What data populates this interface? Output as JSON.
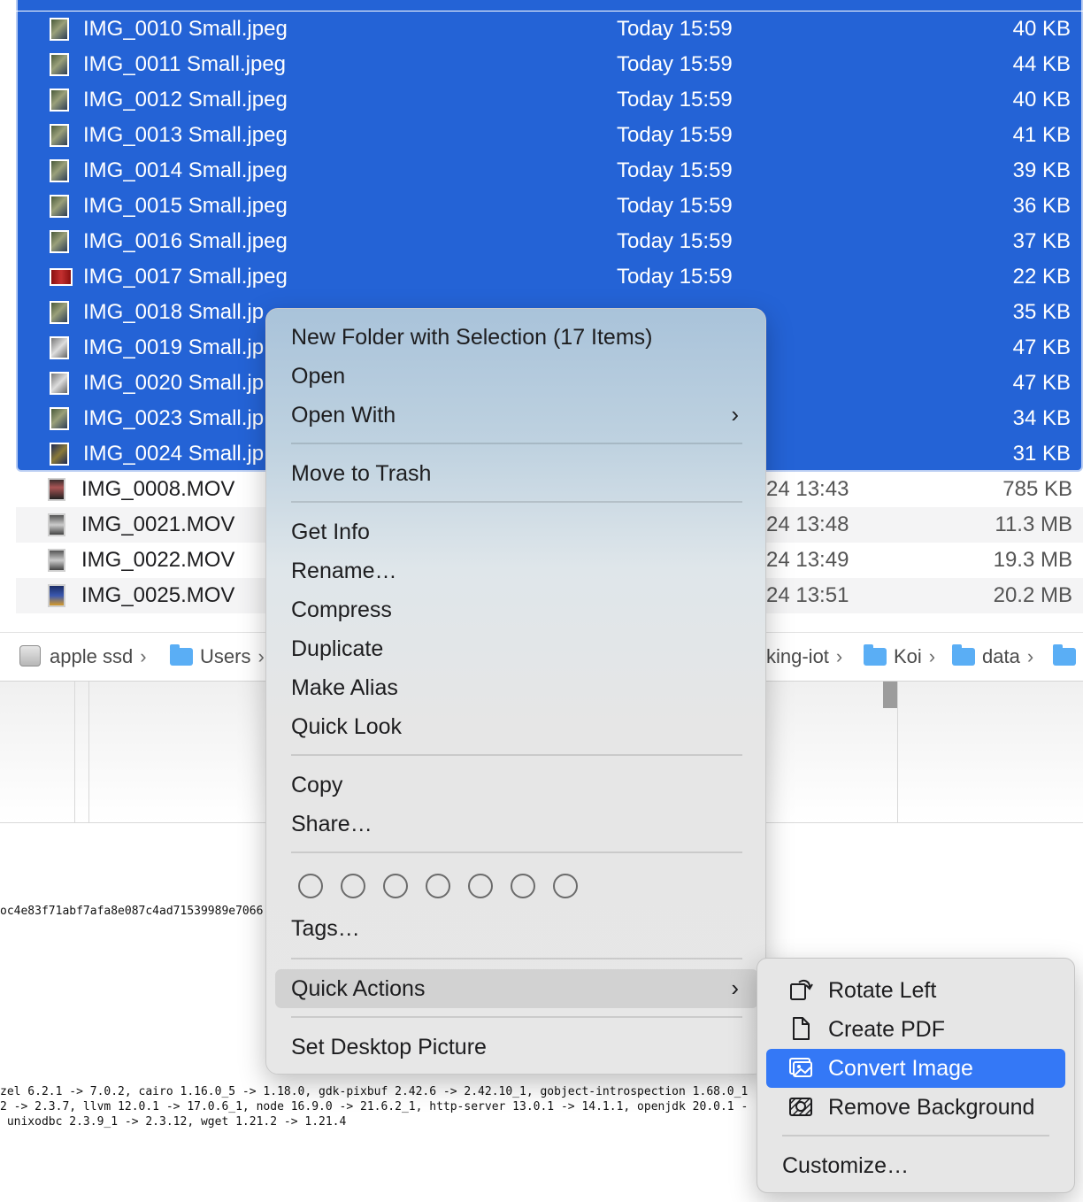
{
  "finder": {
    "selected_files": [
      {
        "name": "IMG_0010 Small.jpeg",
        "date": "Today 15:59",
        "size": "40 KB"
      },
      {
        "name": "IMG_0011 Small.jpeg",
        "date": "Today 15:59",
        "size": "44 KB"
      },
      {
        "name": "IMG_0012 Small.jpeg",
        "date": "Today 15:59",
        "size": "40 KB"
      },
      {
        "name": "IMG_0013 Small.jpeg",
        "date": "Today 15:59",
        "size": "41 KB"
      },
      {
        "name": "IMG_0014 Small.jpeg",
        "date": "Today 15:59",
        "size": "39 KB"
      },
      {
        "name": "IMG_0015 Small.jpeg",
        "date": "Today 15:59",
        "size": "36 KB"
      },
      {
        "name": "IMG_0016 Small.jpeg",
        "date": "Today 15:59",
        "size": "37 KB"
      },
      {
        "name": "IMG_0017 Small.jpeg",
        "date": "Today 15:59",
        "size": "22 KB"
      },
      {
        "name": "IMG_0018 Small.jp",
        "date": "",
        "size": "35 KB"
      },
      {
        "name": "IMG_0019 Small.jp",
        "date": "",
        "size": "47 KB"
      },
      {
        "name": "IMG_0020 Small.jp",
        "date": "",
        "size": "47 KB"
      },
      {
        "name": "IMG_0023 Small.jp",
        "date": "",
        "size": "34 KB"
      },
      {
        "name": "IMG_0024 Small.jp",
        "date": "",
        "size": "31 KB"
      }
    ],
    "other_files": [
      {
        "name": "IMG_0008.MOV",
        "date": ")24 13:43",
        "size": "785 KB"
      },
      {
        "name": "IMG_0021.MOV",
        "date": ")24 13:48",
        "size": "11.3 MB"
      },
      {
        "name": "IMG_0022.MOV",
        "date": ")24 13:49",
        "size": "19.3 MB"
      },
      {
        "name": "IMG_0025.MOV",
        "date": ")24 13:51",
        "size": "20.2 MB"
      }
    ]
  },
  "path_bar": {
    "disk": "apple ssd",
    "users": "Users",
    "partial": "king-iot",
    "koi": "Koi",
    "data": "data"
  },
  "terminal": {
    "hash": "oc4e83f71abf7afa8e087c4ad71539989e7066",
    "line1": "zel 6.2.1 -> 7.0.2, cairo 1.16.0_5 -> 1.18.0, gdk-pixbuf 2.42.6 -> 2.42.10_1, gobject-introspection 1.68.0_1",
    "line2": "2 -> 2.3.7, llvm 12.0.1 -> 17.0.6_1, node 16.9.0 -> 21.6.2_1, http-server 13.0.1 -> 14.1.1, openjdk 20.0.1 -",
    "line3": " unixodbc 2.3.9_1 -> 2.3.12, wget 1.21.2 -> 1.21.4"
  },
  "context_menu": {
    "new_folder": "New Folder with Selection (17 Items)",
    "open": "Open",
    "open_with": "Open With",
    "move_to_trash": "Move to Trash",
    "get_info": "Get Info",
    "rename": "Rename…",
    "compress": "Compress",
    "duplicate": "Duplicate",
    "make_alias": "Make Alias",
    "quick_look": "Quick Look",
    "copy": "Copy",
    "share": "Share…",
    "tags": "Tags…",
    "quick_actions": "Quick Actions",
    "set_desktop_picture": "Set Desktop Picture"
  },
  "submenu": {
    "rotate_left": "Rotate Left",
    "create_pdf": "Create PDF",
    "convert_image": "Convert Image",
    "remove_background": "Remove Background",
    "customize": "Customize…"
  },
  "colors": {
    "selection": "#2463d6",
    "highlight": "#3478f6"
  },
  "icons": [
    "image-thumbnail-icon",
    "video-thumbnail-icon",
    "hard-disk-icon",
    "folder-icon",
    "chevron-right-icon",
    "rotate-left-icon",
    "document-icon",
    "photos-icon",
    "remove-background-icon",
    "tag-circle-icon"
  ]
}
